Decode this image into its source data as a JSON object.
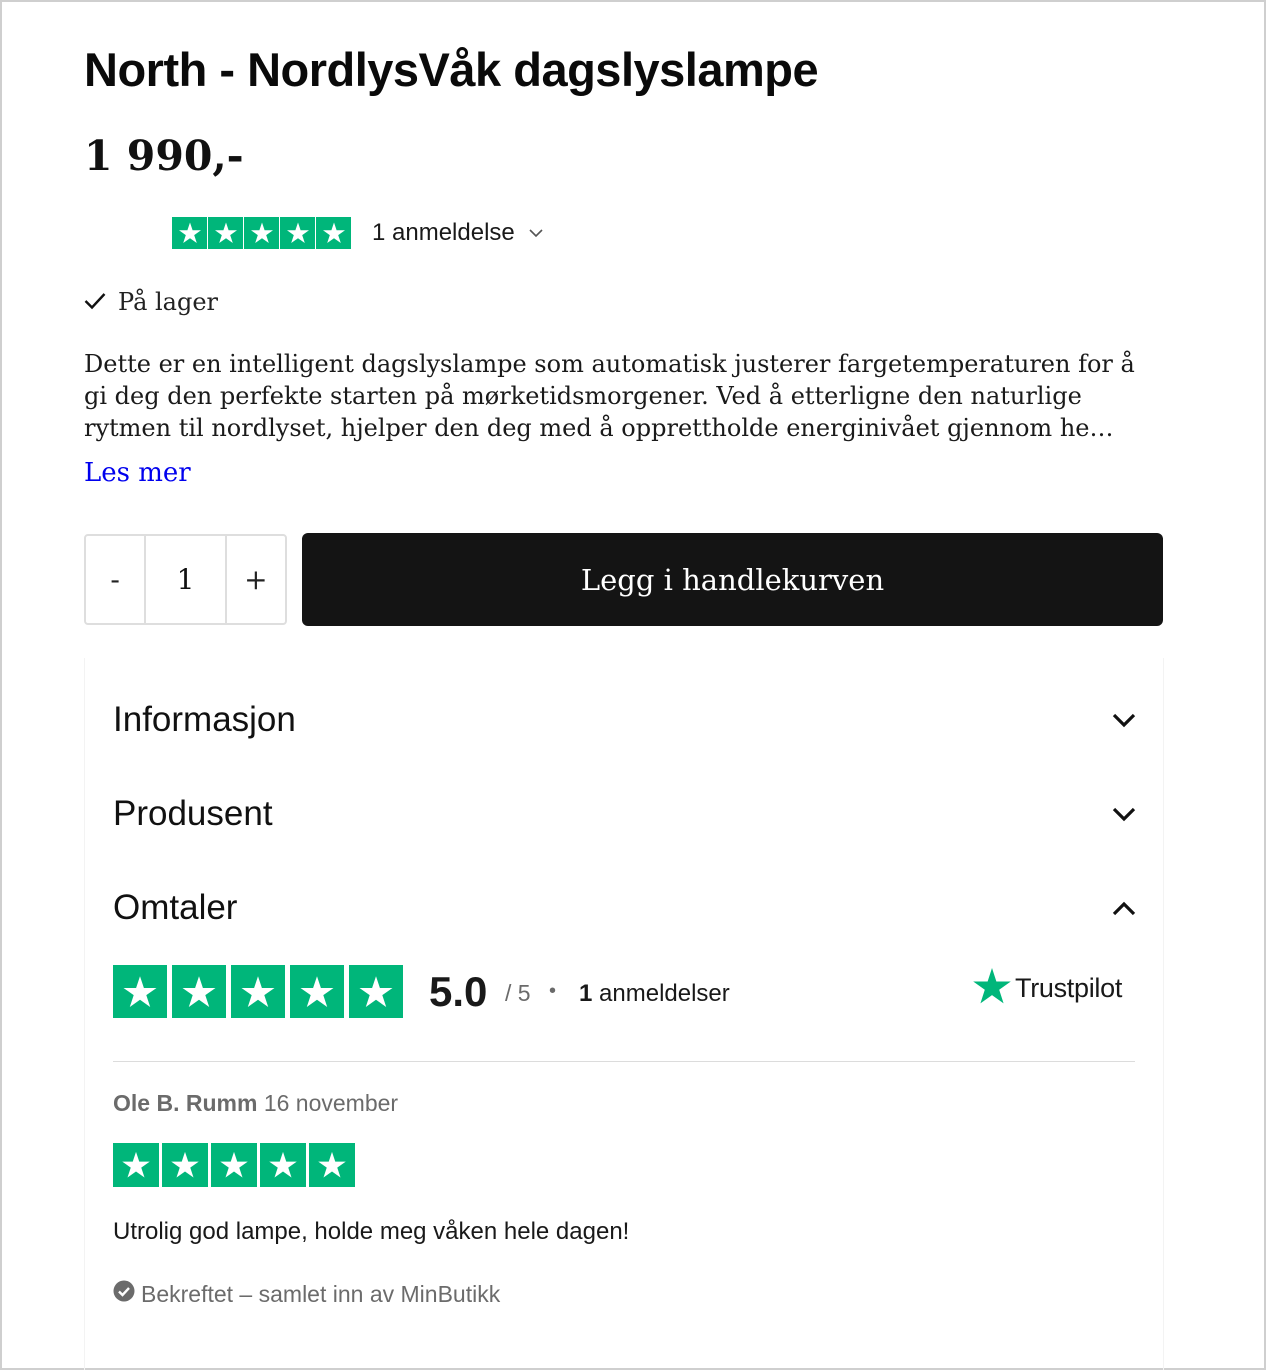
{
  "product": {
    "title": "North - NordlysVåk dagslyslampe",
    "price": "1 990,-",
    "rating_summary": {
      "stars": 5,
      "count_label": "1 anmeldelse"
    },
    "stock_label": "På lager",
    "description_lines": [
      "Dette er en intelligent dagslyslampe som automatisk justerer fargetemperaturen for å",
      "gi deg den perfekte starten på mørketidsmorgener. Ved å etterligne den naturlige",
      "rytmen til nordlyset, hjelper den deg med å opprettholde energinivået gjennom he…"
    ],
    "read_more_label": "Les mer"
  },
  "cart": {
    "minus_label": "-",
    "quantity": "1",
    "plus_label": "+",
    "add_to_cart_label": "Legg i handlekurven"
  },
  "accordion": {
    "sections": [
      {
        "label": "Informasjon",
        "expanded": false
      },
      {
        "label": "Produsent",
        "expanded": false
      },
      {
        "label": "Omtaler",
        "expanded": true
      }
    ]
  },
  "reviews": {
    "summary": {
      "stars": 5,
      "score": "5.0",
      "out_of": "/ 5",
      "separator": "•",
      "count_number": "1",
      "count_label": "anmeldelser",
      "provider": "Trustpilot"
    },
    "items": [
      {
        "author": "Ole B. Rumm",
        "date": "16 november",
        "stars": 5,
        "text": "Utrolig god lampe, holde meg våken hele dagen!",
        "verified_label": "Bekreftet – samlet inn av MinButikk"
      }
    ]
  },
  "colors": {
    "trustpilot_green": "#00b67a",
    "button_black": "#141414",
    "link_blue": "#0000ee",
    "muted_gray": "#6b6b6b"
  },
  "icons": [
    "star-icon",
    "chevron-down-icon",
    "check-icon",
    "chevron-up-icon",
    "trustpilot-star-icon",
    "verified-check-icon"
  ]
}
